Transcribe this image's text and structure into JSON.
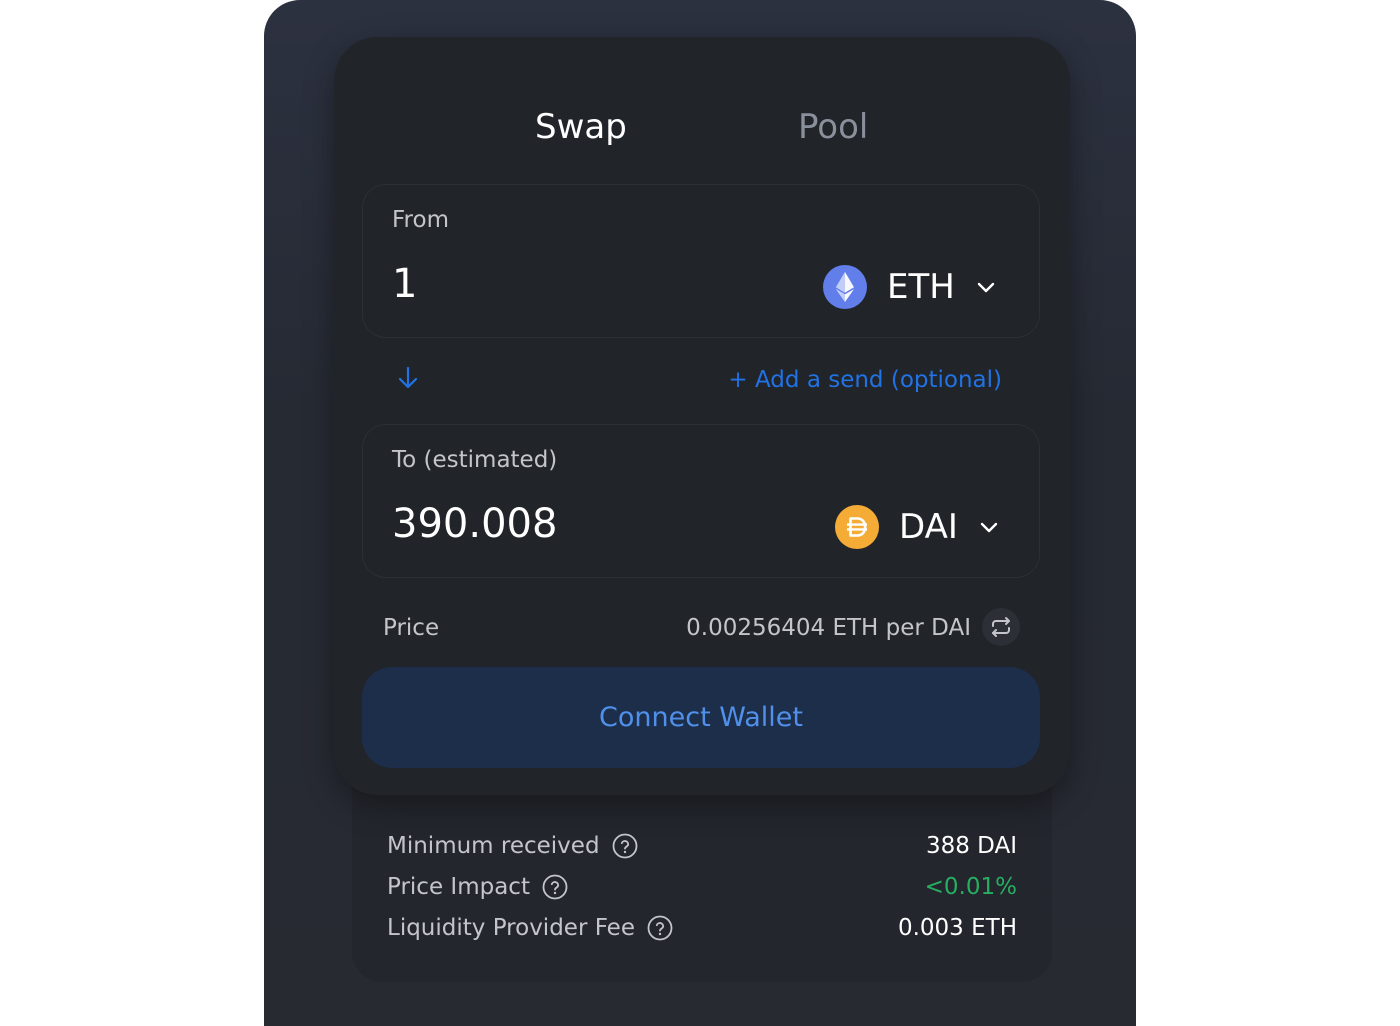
{
  "tabs": {
    "swap": "Swap",
    "pool": "Pool"
  },
  "from": {
    "label": "From",
    "amount": "1",
    "token": "ETH",
    "token_icon": "eth-icon"
  },
  "to": {
    "label": "To (estimated)",
    "amount": "390.008",
    "token": "DAI",
    "token_icon": "dai-icon"
  },
  "add_send": "+ Add a send (optional)",
  "price": {
    "label": "Price",
    "value": "0.00256404 ETH per DAI"
  },
  "connect_label": "Connect Wallet",
  "details": [
    {
      "label": "Minimum received",
      "value": "388 DAI"
    },
    {
      "label": "Price Impact",
      "value": "<0.01%"
    },
    {
      "label": "Liquidity Provider Fee",
      "value": "0.003 ETH"
    }
  ],
  "colors": {
    "card_bg": "#212429",
    "accent_blue": "#2172e5",
    "connect_bg": "#1d2e4a",
    "connect_text": "#5090ea",
    "positive_green": "#27ae60",
    "eth_purple": "#627eea",
    "dai_yellow": "#f5ac37"
  }
}
